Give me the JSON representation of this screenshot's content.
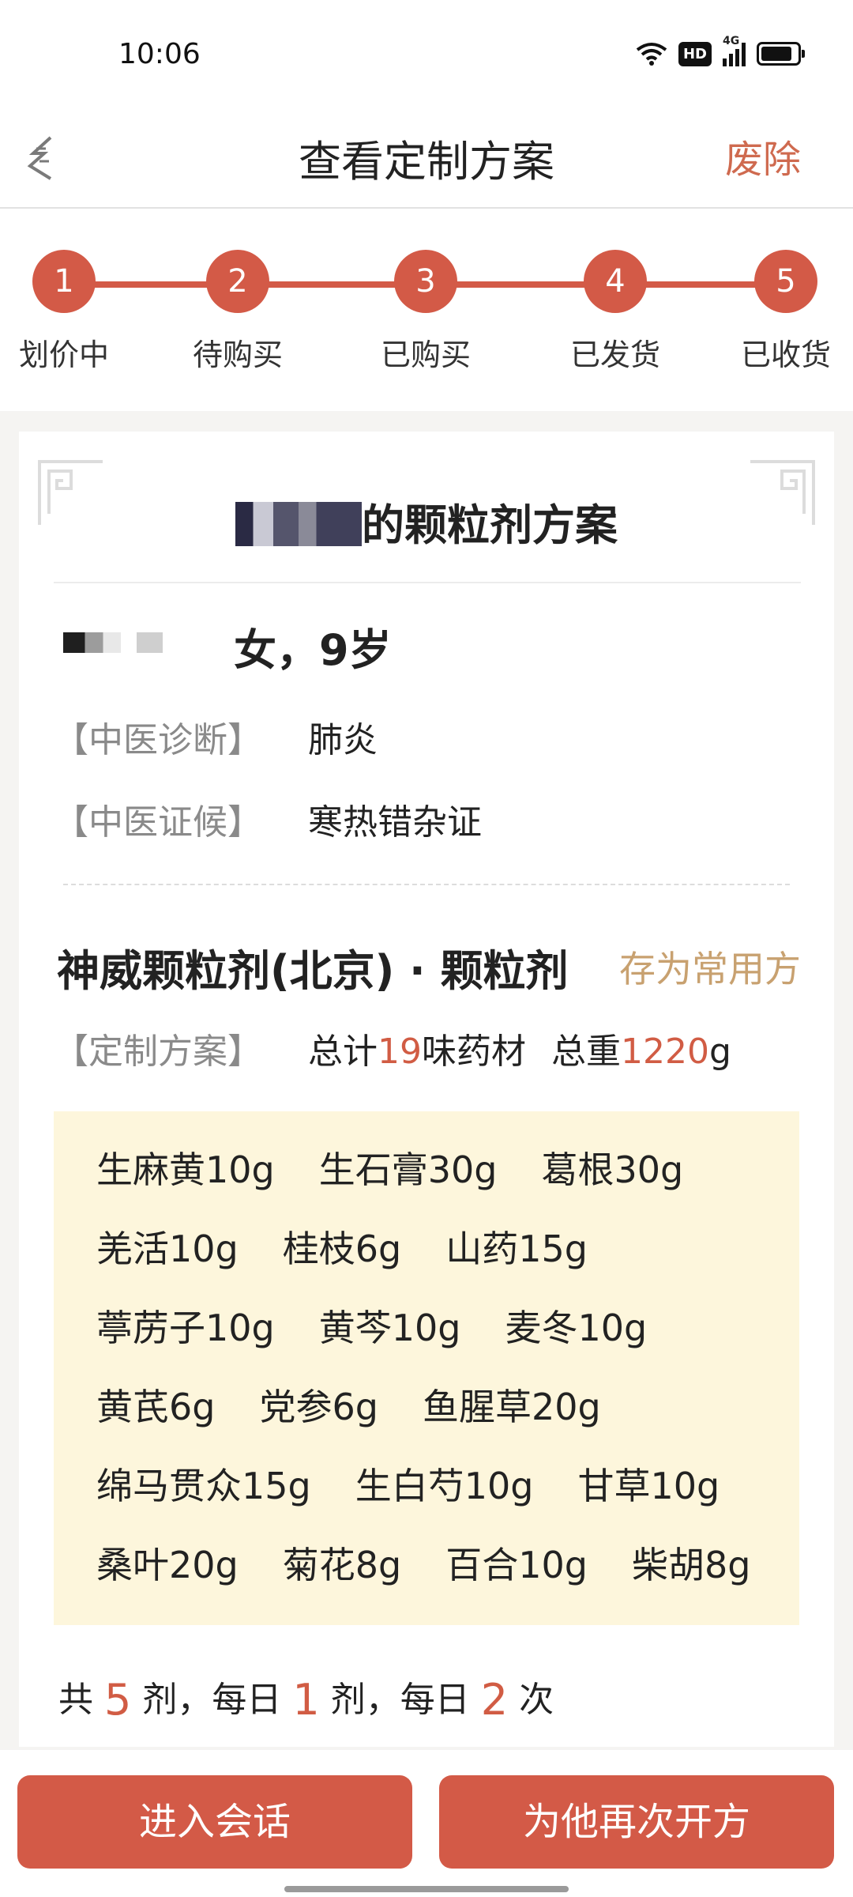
{
  "status_bar": {
    "time": "10:06",
    "hd_label": "HD",
    "network_label": "4G"
  },
  "nav": {
    "title": "查看定制方案",
    "action": "废除"
  },
  "steps": [
    {
      "num": "1",
      "label": "划价中"
    },
    {
      "num": "2",
      "label": "待购买"
    },
    {
      "num": "3",
      "label": "已购买"
    },
    {
      "num": "4",
      "label": "已发货"
    },
    {
      "num": "5",
      "label": "已收货"
    }
  ],
  "card": {
    "title_suffix": "的颗粒剂方案",
    "patient": {
      "info": "女，9岁"
    },
    "diagnosis": {
      "key": "【中医诊断】",
      "value": "肺炎"
    },
    "syndrome": {
      "key": "【中医证候】",
      "value": "寒热错杂证"
    },
    "recipe": {
      "name": "神威颗粒剂(北京) · 颗粒剂",
      "save_label": "存为常用方",
      "plan_key": "【定制方案】",
      "total_prefix": "总计",
      "total_count": "19",
      "total_count_suffix": "味药材",
      "weight_prefix": "总重",
      "total_weight": "1220",
      "weight_unit": "g"
    },
    "herb_rows": [
      [
        "生麻黄10g",
        "生石膏30g",
        "葛根30g"
      ],
      [
        "羌活10g",
        "桂枝6g",
        "山药15g"
      ],
      [
        "葶苈子10g",
        "黄芩10g",
        "麦冬10g"
      ],
      [
        "黄芪6g",
        "党参6g",
        "鱼腥草20g"
      ],
      [
        "绵马贯众15g",
        "生白芍10g",
        "甘草10g"
      ],
      [
        "桑叶20g",
        "菊花8g",
        "百合10g",
        "柴胡8g"
      ]
    ],
    "dosage": {
      "t1": "共",
      "doses": "5",
      "t2": "剂，每日",
      "per_day": "1",
      "t3": "剂，每日",
      "times": "2",
      "t4": "次"
    }
  },
  "buttons": {
    "chat": "进入会话",
    "represcribe": "为他再次开方"
  },
  "colors": {
    "accent": "#d35a47",
    "gold": "#c8a170",
    "herb_bg": "#fdf6dc"
  }
}
